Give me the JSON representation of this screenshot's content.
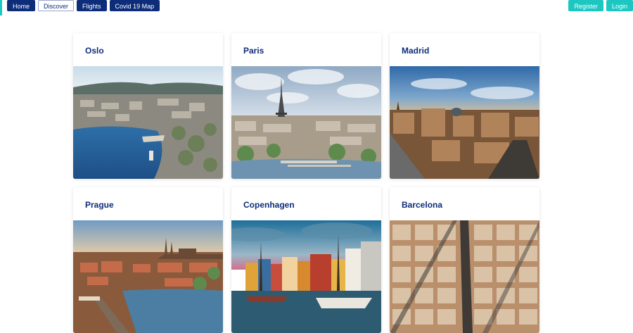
{
  "nav": {
    "items": [
      {
        "label": "Home",
        "active": false
      },
      {
        "label": "Discover",
        "active": true
      },
      {
        "label": "Flights",
        "active": false
      },
      {
        "label": "Covid 19 Map",
        "active": false
      }
    ]
  },
  "auth": {
    "register_label": "Register",
    "login_label": "Login"
  },
  "cities": [
    {
      "name": "Oslo"
    },
    {
      "name": "Paris"
    },
    {
      "name": "Madrid"
    },
    {
      "name": "Prague"
    },
    {
      "name": "Copenhagen"
    },
    {
      "name": "Barcelona"
    }
  ],
  "colors": {
    "nav_primary": "#0d2d7a",
    "accent_teal": "#1cc7c1",
    "card_title": "#0d2d7a"
  }
}
